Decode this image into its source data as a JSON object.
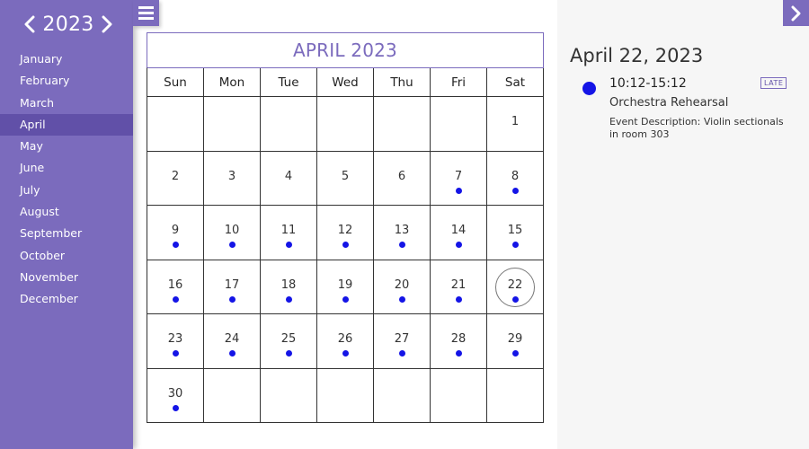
{
  "sidebar": {
    "year": "2023",
    "prev_icon": "chevron-left-icon",
    "next_icon": "chevron-right-icon",
    "months": [
      "January",
      "February",
      "March",
      "April",
      "May",
      "June",
      "July",
      "August",
      "September",
      "October",
      "November",
      "December"
    ],
    "active_month_index": 3
  },
  "menu_icon": "hamburger-menu-icon",
  "calendar": {
    "title": "APRIL 2023",
    "weekdays": [
      "Sun",
      "Mon",
      "Tue",
      "Wed",
      "Thu",
      "Fri",
      "Sat"
    ],
    "leading_blank_days": 6,
    "days_in_month": 30,
    "days_with_events": [
      7,
      8,
      9,
      10,
      11,
      12,
      13,
      14,
      15,
      16,
      17,
      18,
      19,
      20,
      21,
      22,
      23,
      24,
      25,
      26,
      27,
      28,
      29,
      30
    ],
    "selected_day": 22
  },
  "panel": {
    "toggle_icon": "chevron-right-icon",
    "date": "April 22, 2023",
    "event": {
      "time": "10:12-15:12",
      "badge": "LATE",
      "title": "Orchestra Rehearsal",
      "description": "Event Description: Violin sectionals in room 303"
    }
  },
  "colors": {
    "accent": "#7b6bbd",
    "accent_dark": "#6150a8",
    "event_dot": "#1414e6",
    "panel_bg": "#f6f6f6"
  }
}
